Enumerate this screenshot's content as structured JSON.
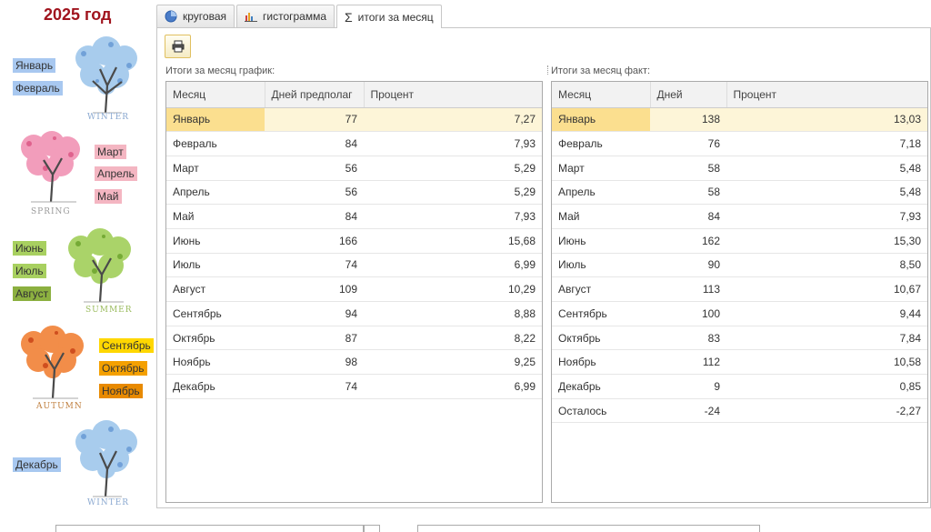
{
  "year": "2025 год",
  "months_left": {
    "jan": "Январь",
    "feb": "Февраль",
    "mar": "Март",
    "apr": "Апрель",
    "may": "Май",
    "jun": "Июнь",
    "jul": "Июль",
    "aug": "Август",
    "sep": "Сентябрь",
    "oct": "Октябрь",
    "nov": "Ноябрь",
    "dec": "Декабрь"
  },
  "seasons": {
    "winter": "WINTER",
    "spring": "SPRING",
    "summer": "SUMMER",
    "autumn": "AUTUMN",
    "winter2": "WINTER"
  },
  "colors": {
    "winter": "#a8c8f0",
    "spring": "#f4b6c2",
    "summer": "#a8d060",
    "summer_dark": "#8cb040",
    "autumn_yellow": "#ffd700",
    "autumn_orange": "#f4a000",
    "autumn_dark": "#e88a00",
    "year": "#a0141e"
  },
  "tabs": [
    {
      "label": "круговая",
      "icon": "pie-chart-icon"
    },
    {
      "label": "гистограмма",
      "icon": "bar-chart-icon"
    },
    {
      "label": "итоги за месяц",
      "icon": "sigma-icon"
    }
  ],
  "toolbar": {
    "print_icon": "printer-icon"
  },
  "left_table": {
    "caption": "Итоги за месяц график:",
    "headers": [
      "Месяц",
      "Дней предполаг",
      "Процент"
    ],
    "rows": [
      [
        "Январь",
        "77",
        "7,27"
      ],
      [
        "Февраль",
        "84",
        "7,93"
      ],
      [
        "Март",
        "56",
        "5,29"
      ],
      [
        "Апрель",
        "56",
        "5,29"
      ],
      [
        "Май",
        "84",
        "7,93"
      ],
      [
        "Июнь",
        "166",
        "15,68"
      ],
      [
        "Июль",
        "74",
        "6,99"
      ],
      [
        "Август",
        "109",
        "10,29"
      ],
      [
        "Сентябрь",
        "94",
        "8,88"
      ],
      [
        "Октябрь",
        "87",
        "8,22"
      ],
      [
        "Ноябрь",
        "98",
        "9,25"
      ],
      [
        "Декабрь",
        "74",
        "6,99"
      ]
    ]
  },
  "right_table": {
    "caption": "Итоги за месяц факт:",
    "headers": [
      "Месяц",
      "Дней",
      "Процент"
    ],
    "rows": [
      [
        "Январь",
        "138",
        "13,03"
      ],
      [
        "Февраль",
        "76",
        "7,18"
      ],
      [
        "Март",
        "58",
        "5,48"
      ],
      [
        "Апрель",
        "58",
        "5,48"
      ],
      [
        "Май",
        "84",
        "7,93"
      ],
      [
        "Июнь",
        "162",
        "15,30"
      ],
      [
        "Июль",
        "90",
        "8,50"
      ],
      [
        "Август",
        "113",
        "10,67"
      ],
      [
        "Сентябрь",
        "100",
        "9,44"
      ],
      [
        "Октябрь",
        "83",
        "7,84"
      ],
      [
        "Ноябрь",
        "112",
        "10,58"
      ],
      [
        "Декабрь",
        "9",
        "0,85"
      ],
      [
        "Осталось",
        "-24",
        "-2,27"
      ]
    ]
  }
}
